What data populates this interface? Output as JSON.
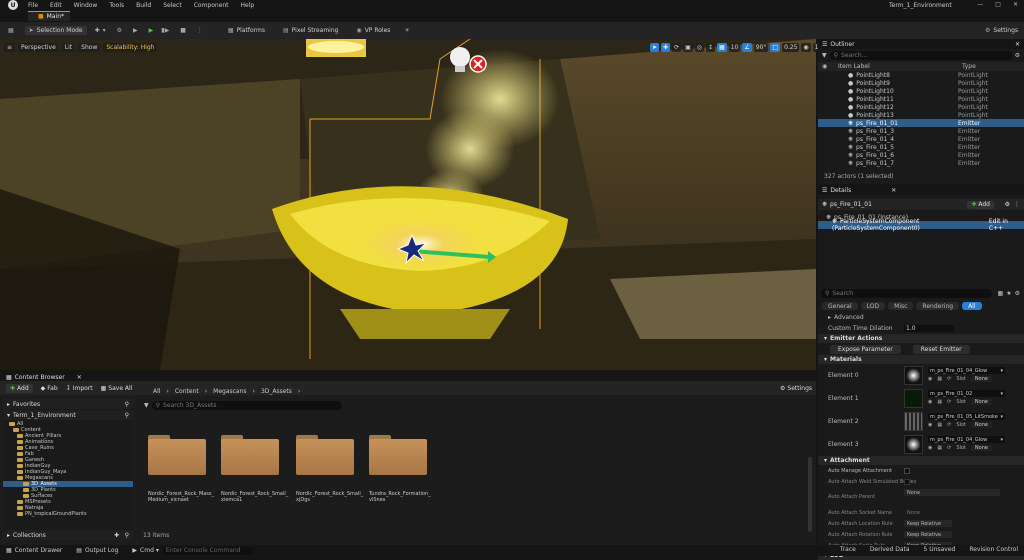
{
  "menubar": {
    "items": [
      "File",
      "Edit",
      "Window",
      "Tools",
      "Build",
      "Select",
      "Component",
      "Help"
    ],
    "title": "Term_1_Environment"
  },
  "tab": {
    "label": "Main*"
  },
  "toolbar": {
    "selection_mode": "Selection Mode",
    "platforms": "Platforms",
    "pixel_streaming": "Pixel Streaming",
    "vp_roles": "VP Roles",
    "settings": "Settings"
  },
  "viewport": {
    "perspective": "Perspective",
    "lit": "Lit",
    "show": "Show",
    "scalability": "Scalability: High",
    "angle": "90°",
    "speed": "10",
    "scale": "0.25",
    "grid": "10"
  },
  "outliner": {
    "title": "Outliner",
    "search_placeholder": "Search...",
    "col_label": "Item Label",
    "col_type": "Type",
    "rows": [
      {
        "name": "PointLight8",
        "type": "PointLight"
      },
      {
        "name": "PointLight9",
        "type": "PointLight"
      },
      {
        "name": "PointLight10",
        "type": "PointLight"
      },
      {
        "name": "PointLight11",
        "type": "PointLight"
      },
      {
        "name": "PointLight12",
        "type": "PointLight"
      },
      {
        "name": "PointLight13",
        "type": "PointLight"
      },
      {
        "name": "ps_Fire_01_01",
        "type": "Emitter"
      },
      {
        "name": "ps_Fire_01_3",
        "type": "Emitter"
      },
      {
        "name": "ps_Fire_01_4",
        "type": "Emitter"
      },
      {
        "name": "ps_Fire_01_5",
        "type": "Emitter"
      },
      {
        "name": "ps_Fire_01_6",
        "type": "Emitter"
      },
      {
        "name": "ps_Fire_01_7",
        "type": "Emitter"
      }
    ],
    "footer": "327 actors (1 selected)"
  },
  "details": {
    "title": "Details",
    "actor": "ps_Fire_01_01",
    "add": "Add",
    "instance": "ps_Fire_01_01 (Instance)",
    "component": "ParticleSystemComponent (ParticleSystemComponent0)",
    "edit_cpp": "Edit in C++",
    "search_placeholder": "Search",
    "filters": [
      "General",
      "LOD",
      "Misc",
      "Rendering",
      "All"
    ],
    "advanced": "Advanced",
    "custom_time_label": "Custom Time Dilation",
    "custom_time_value": "1.0",
    "emitter_actions": "Emitter Actions",
    "expose": "Expose Parameter",
    "reset": "Reset Emitter",
    "materials": "Materials",
    "elements": [
      {
        "label": "Element 0",
        "mat": "m_ps_Fire_01_04_Glow",
        "source": "Slot",
        "slot": "None"
      },
      {
        "label": "Element 1",
        "mat": "m_ps_Fire_01_02",
        "source": "Slot",
        "slot": "None"
      },
      {
        "label": "Element 2",
        "mat": "m_ps_Fire_01_05_LitSmoke",
        "source": "Slot",
        "slot": "None"
      },
      {
        "label": "Element 3",
        "mat": "m_ps_Fire_01_04_Glow",
        "source": "Slot",
        "slot": "None"
      }
    ],
    "attachment": "Attachment",
    "attach_rows": [
      {
        "label": "Auto Manage Attachment",
        "value": ""
      },
      {
        "label": "Auto Attach Weld Simulated Bodies",
        "value": ""
      },
      {
        "label": "Auto Attach Parent",
        "value": "None"
      },
      {
        "label": "Auto Attach Socket Name",
        "value": "None"
      },
      {
        "label": "Auto Attach Location Rule",
        "value": "Keep Relative"
      },
      {
        "label": "Auto Attach Rotation Rule",
        "value": "Keep Relative"
      },
      {
        "label": "Auto Attach Scale Rule",
        "value": "Keep Relative"
      }
    ],
    "lod": "LOD"
  },
  "content_browser": {
    "tab": "Content Browser",
    "add": "Add",
    "fab": "Fab",
    "import": "Import",
    "save_all": "Save All",
    "settings": "Settings",
    "breadcrumb": [
      "All",
      "Content",
      "Megascans",
      "3D_Assets"
    ],
    "search_placeholder": "Search 3D_Assets",
    "favorites": "Favorites",
    "project": "Term_1_Environment",
    "collections": "Collections",
    "folders": [
      "All",
      "Content",
      "Ancient_Pillars",
      "Animations",
      "Cave_Ruins",
      "Fab",
      "Ganesh",
      "IndianGuy",
      "IndianGuy_Maya",
      "Megascans",
      "3D_Assets",
      "3D_Plants",
      "Surfaces",
      "MSPresets",
      "Natraja",
      "PN_tropicalGroundPlants"
    ],
    "assets": [
      "Nordic_Forest_Rock_Mass_\nMedium_xicnaet",
      "Nordic_Forest_Rock_Small_\nxiemca1",
      "Nordic_Forest_Rock_Small_\nxjDgs",
      "Tundra_Rock_Formation_\nvlSnes"
    ],
    "count": "13 items"
  },
  "statusbar": {
    "content_drawer": "Content Drawer",
    "output_log": "Output Log",
    "cmd": "Cmd",
    "cmd_placeholder": "Enter Console Command",
    "trace": "Trace",
    "derived": "Derived Data",
    "unsaved": "5 Unsaved",
    "revision": "Revision Control"
  }
}
